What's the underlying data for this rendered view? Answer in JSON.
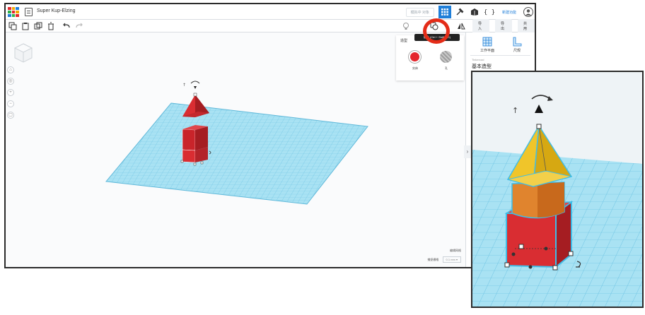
{
  "app": {
    "title": "Super Kup-Elzing"
  },
  "titlebar": {
    "mode_label": "模拟中 对象",
    "new_label": "新建功能",
    "icons": [
      "grid-view-icon",
      "hammer-icon",
      "box-icon",
      "code-blocks-icon",
      "user-icon"
    ]
  },
  "toolbar": {
    "tools": [
      "copy-icon",
      "paste-icon",
      "duplicate-icon",
      "delete-icon",
      "undo-icon",
      "redo-icon"
    ],
    "right_buttons": [
      "导入",
      "导出",
      "共用"
    ],
    "tooltip": "组合 (Ctrl + Shift + G)"
  },
  "inspector": {
    "title": "造型",
    "solid_label": "实体",
    "hole_label": "孔",
    "solid_color": "#e4262c",
    "hole_color": "#9e9e9e"
  },
  "right_panel": {
    "workplane_label": "工作平面",
    "ruler_label": "尺规",
    "library_label": "Tinkercad",
    "library_name": "基本造型"
  },
  "workplane": {
    "edit_grid_label": "编辑网格",
    "snap_label": "捕捉栅格",
    "snap_value": "0.1 mm ▾"
  },
  "colors": {
    "accent": "#1f7ed8",
    "highlight_ring": "#e42c18",
    "workplane": "#a9e2f3",
    "grid_line": "#6cc3e3",
    "box": "#d92d32",
    "cylinder": "#e0842e",
    "roof": "#f0c52a"
  }
}
